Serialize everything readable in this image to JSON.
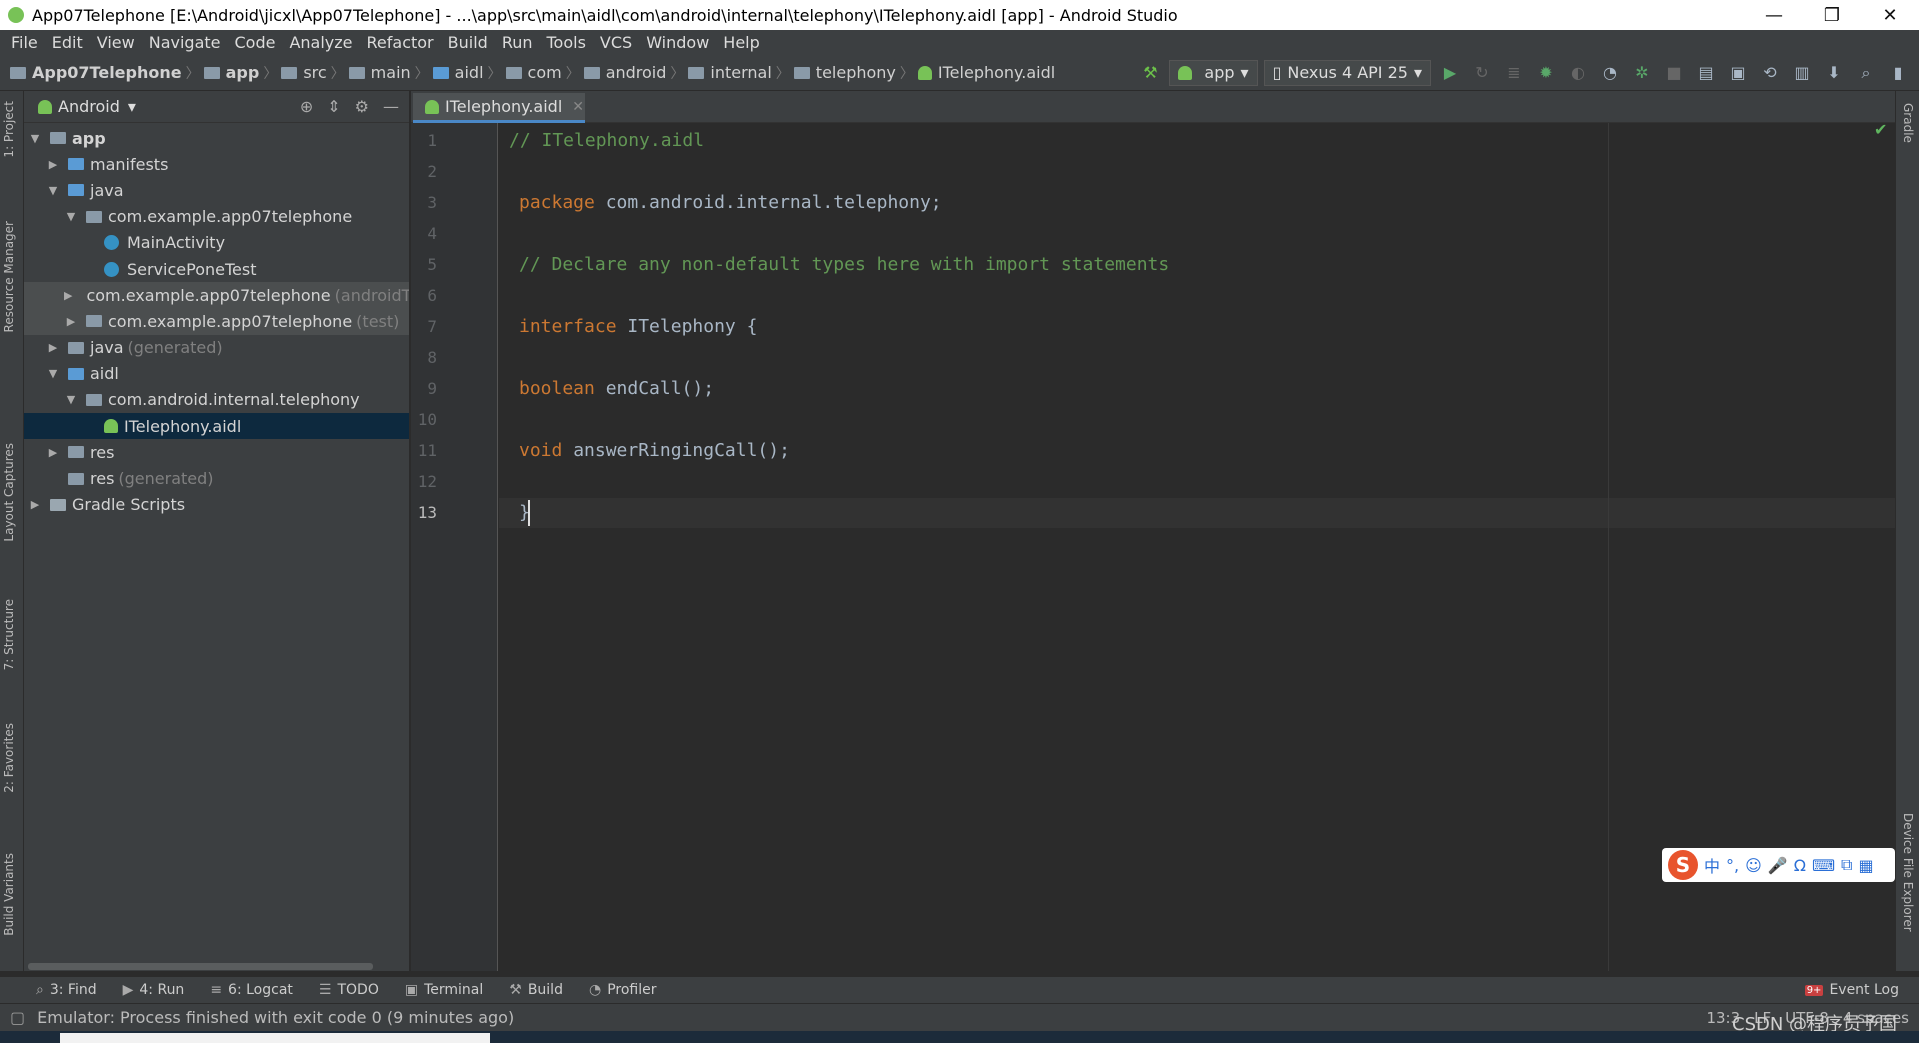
{
  "window": {
    "title": "App07Telephone [E:\\Android\\jicxl\\App07Telephone] - ...\\app\\src\\main\\aidl\\com\\android\\internal\\telephony\\ITelephony.aidl [app] - Android Studio",
    "minimize": "—",
    "restore": "❐",
    "close": "✕"
  },
  "menu": [
    "File",
    "Edit",
    "View",
    "Navigate",
    "Code",
    "Analyze",
    "Refactor",
    "Build",
    "Run",
    "Tools",
    "VCS",
    "Window",
    "Help"
  ],
  "breadcrumb": [
    "App07Telephone",
    "app",
    "src",
    "main",
    "aidl",
    "com",
    "android",
    "internal",
    "telephony",
    "ITelephony.aidl"
  ],
  "toolbar": {
    "run_config": "app",
    "device": "Nexus 4 API 25"
  },
  "left_tabs": [
    "1: Project",
    "Resource Manager",
    "Layout Captures",
    "7: Structure",
    "2: Favorites",
    "Build Variants"
  ],
  "right_tabs": [
    "Gradle",
    "Device File Explorer"
  ],
  "project": {
    "view": "Android",
    "tree": [
      {
        "label": "app",
        "suffix": ""
      },
      {
        "label": "manifests",
        "suffix": ""
      },
      {
        "label": "java",
        "suffix": ""
      },
      {
        "label": "com.example.app07telephone",
        "suffix": ""
      },
      {
        "label": "MainActivity",
        "suffix": ""
      },
      {
        "label": "ServicePoneTest",
        "suffix": ""
      },
      {
        "label": "com.example.app07telephone",
        "suffix": "(androidTest)"
      },
      {
        "label": "com.example.app07telephone",
        "suffix": "(test)"
      },
      {
        "label": "java",
        "suffix": "(generated)"
      },
      {
        "label": "aidl",
        "suffix": ""
      },
      {
        "label": "com.android.internal.telephony",
        "suffix": ""
      },
      {
        "label": "ITelephony.aidl",
        "suffix": ""
      },
      {
        "label": "res",
        "suffix": ""
      },
      {
        "label": "res",
        "suffix": "(generated)"
      },
      {
        "label": "Gradle Scripts",
        "suffix": ""
      }
    ]
  },
  "editor": {
    "tab": "ITelephony.aidl",
    "line_numbers": [
      "1",
      "2",
      "3",
      "4",
      "5",
      "6",
      "7",
      "8",
      "9",
      "10",
      "11",
      "12",
      "13"
    ],
    "lines": {
      "l1": "// ITelephony.aidl",
      "l3_kw": "package",
      "l3_rest": " com.android.internal.telephony;",
      "l5": "// Declare any non-default types here with import statements",
      "l7_kw": "interface",
      "l7_rest": " ITelephony {",
      "l9_kw": "boolean",
      "l9_rest": " endCall();",
      "l11_kw": "void",
      "l11_rest": " answerRingingCall();",
      "l13": "}"
    }
  },
  "bottom_tools": [
    {
      "icon": "⌕",
      "label": "3: Find"
    },
    {
      "icon": "▶",
      "label": "4: Run"
    },
    {
      "icon": "≡",
      "label": "6: Logcat"
    },
    {
      "icon": "☰",
      "label": "TODO"
    },
    {
      "icon": "▣",
      "label": "Terminal"
    },
    {
      "icon": "⚒",
      "label": "Build"
    },
    {
      "icon": "◔",
      "label": "Profiler"
    }
  ],
  "event_log": "Event Log",
  "event_badge": "9+",
  "status": {
    "message": "Emulator: Process finished with exit code 0 (9 minutes ago)",
    "position": "13:3",
    "line_sep": "LF",
    "encoding": "UTF-8",
    "indent": "4 spaces"
  },
  "ime": {
    "logo": "S",
    "mode": "中",
    "punct": "°,",
    "emoji": "☺",
    "mic": "🎤",
    "headset": "Ω",
    "keyboard": "⌨",
    "skin": "⧉",
    "grid": "▦"
  },
  "watermark": "CSDN @程序员予国"
}
